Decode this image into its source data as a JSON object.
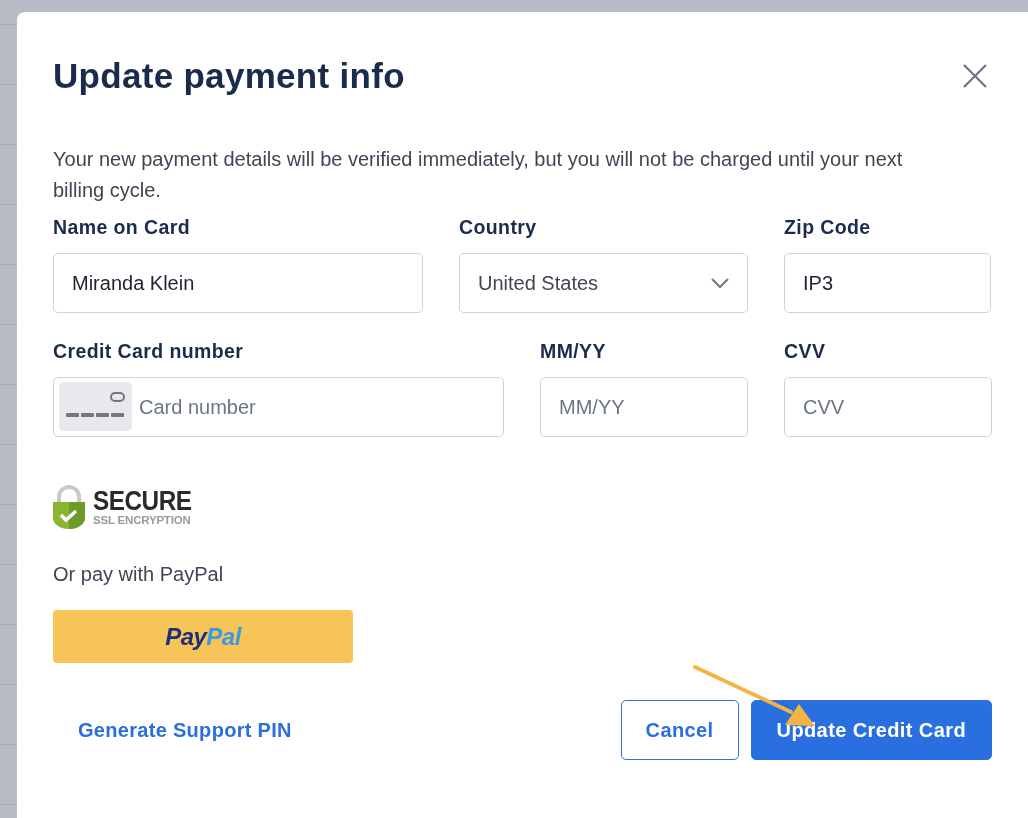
{
  "dialog": {
    "title": "Update payment info",
    "description": "Your new payment details will be verified immediately, but you will not be charged until your next billing cycle.",
    "fields": [
      {
        "label": "Name on Card",
        "kind": "text",
        "value": "Miranda Klein"
      },
      {
        "label": "Country",
        "kind": "select",
        "value": "United States"
      },
      {
        "label": "Zip Code",
        "kind": "text",
        "value": "IP3"
      },
      {
        "label": "Credit Card number",
        "kind": "card",
        "placeholder": "Card number"
      },
      {
        "label": "MM/YY",
        "kind": "text",
        "placeholder": "MM/YY"
      },
      {
        "label": "CVV",
        "kind": "text",
        "placeholder": "CVV"
      }
    ],
    "security_badge": {
      "title": "SECURE",
      "subtitle": "SSL ENCRYPTION"
    },
    "paypal": {
      "prompt": "Or pay with PayPal",
      "logo_first": "Pay",
      "logo_second": "Pal"
    },
    "support_link": "Generate Support PIN",
    "buttons": [
      {
        "label": "Cancel",
        "kind": "secondary"
      },
      {
        "label": "Update Credit Card",
        "kind": "primary"
      }
    ]
  }
}
